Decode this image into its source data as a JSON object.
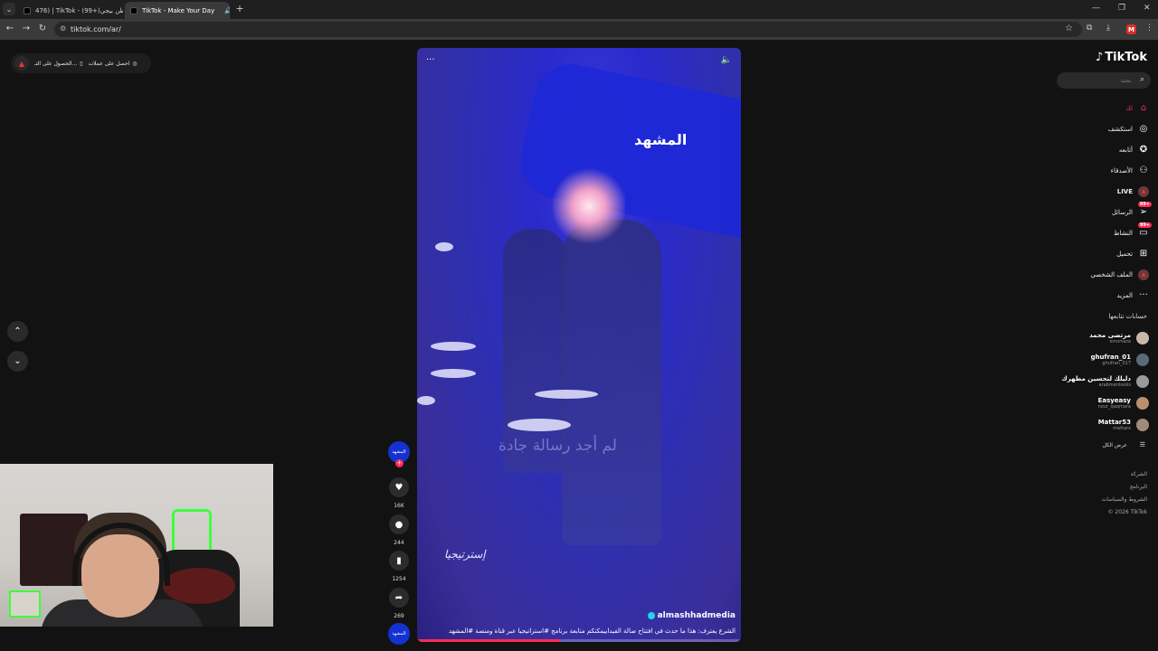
{
  "browser": {
    "tabs": [
      {
        "title": "476) | TikTok - (99+)وطن بيجي",
        "close": "×",
        "active": false
      },
      {
        "title": "TikTok - Make Your Day",
        "close": "×",
        "active": true
      }
    ],
    "new_tab": "+",
    "address": "tiktok.com/ar/",
    "window": {
      "minimize": "—",
      "maximize": "❐",
      "close": "✕"
    },
    "profile_initial": "M"
  },
  "banner": {
    "get_app_label": "الحصول على التـ...",
    "get_coins_label": "احصل على عملات"
  },
  "feed_nav": {
    "up": "⌃",
    "down": "⌄"
  },
  "video": {
    "brand_overlay": "المشهد",
    "ghost_text": "لم أجد رسالة جادة",
    "signature": "إسترتيجيا",
    "author": "almashhadmedia",
    "caption": "الشرع يعترف: هذا ما حدث في افتتاح صالة الفيدابيمكنكم متابعة برنامج #استراتيجيا عبر قناة ومنصة #المشهد",
    "progress": 0.44
  },
  "actions": {
    "channel_label": "المشهد",
    "likes": "16K",
    "comments": "244",
    "saves": "1254",
    "shares": "269",
    "bottom_label": "المشهد"
  },
  "sidebar": {
    "logo": "TikTok",
    "search_placeholder": "بحث",
    "nav": [
      {
        "label": "لك",
        "icon": "home-icon",
        "badge": ""
      },
      {
        "label": "استكشف",
        "icon": "compass-icon",
        "badge": ""
      },
      {
        "label": "أتابعه",
        "icon": "following-icon",
        "badge": ""
      },
      {
        "label": "الأصدقاء",
        "icon": "friends-icon",
        "badge": ""
      },
      {
        "label": "LIVE",
        "icon": "live-icon",
        "badge": ""
      },
      {
        "label": "الرسائل",
        "icon": "messages-icon",
        "badge": "99+"
      },
      {
        "label": "النشاط",
        "icon": "activity-icon",
        "badge": "99+"
      },
      {
        "label": "تحميل",
        "icon": "upload-icon",
        "badge": ""
      },
      {
        "label": "الملف الشخصي",
        "icon": "profile-icon",
        "badge": ""
      },
      {
        "label": "المزيد",
        "icon": "more-icon",
        "badge": ""
      }
    ],
    "following_title": "حسابات تتابعها",
    "following": [
      {
        "name": "مرتضى محمد",
        "handle": "xmortaza"
      },
      {
        "name": "ghufran_01",
        "handle": "ghufran_017"
      },
      {
        "name": "دليلك لتحسين مظهرك",
        "handle": "arabmenlooks"
      },
      {
        "name": "Easyeasy",
        "handle": "nour_qaqmara"
      },
      {
        "name": "Mattar53",
        "handle": "mattarx"
      }
    ],
    "see_all": "عرض الكل",
    "footer": [
      "الشركة",
      "البرنامج",
      "الشروط والسياسات",
      "© 2026 TikTok"
    ]
  }
}
